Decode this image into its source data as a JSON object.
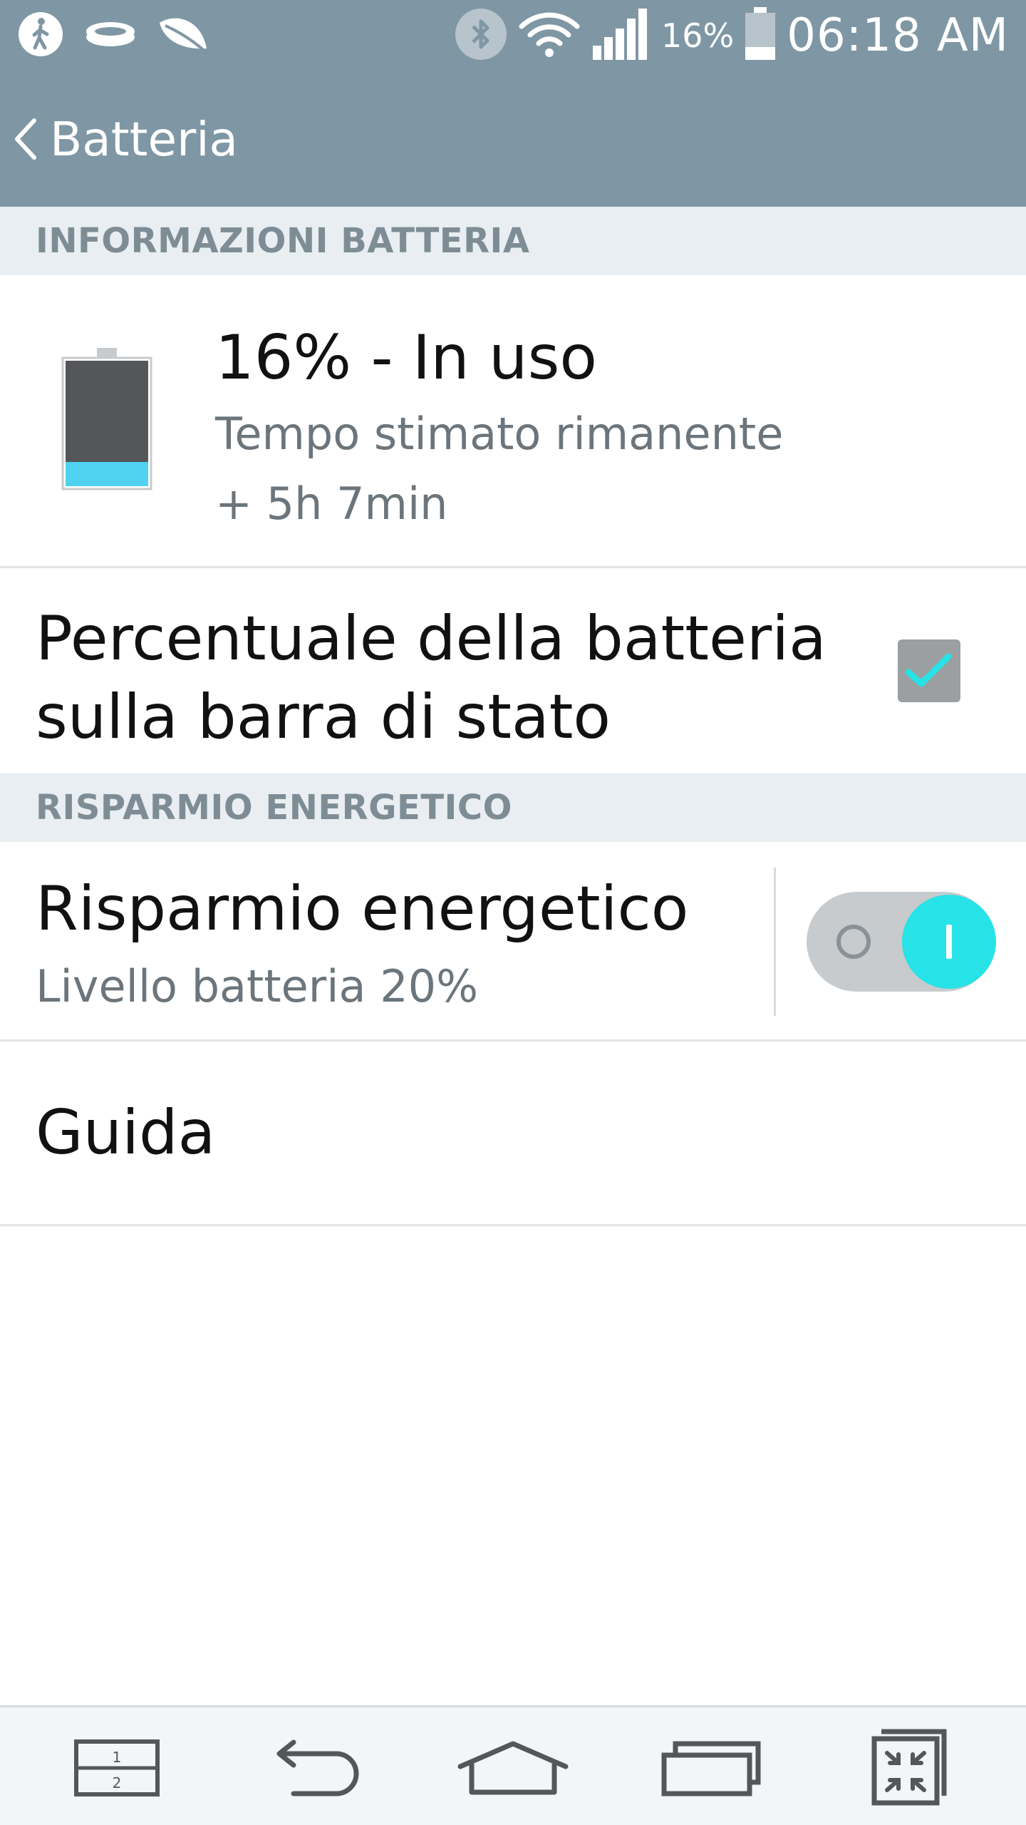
{
  "status_bar": {
    "left_icons": [
      "accessibility-icon",
      "ring-icon",
      "leaf-icon"
    ],
    "right_icons": [
      "bluetooth-icon",
      "wifi-icon",
      "signal-icon",
      "battery-icon"
    ],
    "battery_percent": "16%",
    "time": "06:18 AM"
  },
  "header": {
    "back_icon": "chevron-left-icon",
    "title": "Batteria"
  },
  "sections": {
    "battery_info": "INFORMAZIONI BATTERIA",
    "power_saving": "RISPARMIO ENERGETICO"
  },
  "battery_info": {
    "status": "16% - In uso",
    "estimate_label": "Tempo stimato rimanente",
    "estimate_value": "+ 5h 7min",
    "level_fraction": 0.16,
    "fill_color": "#4fd2f0"
  },
  "percent_setting": {
    "label": "Percentuale della batteria sulla barra di stato",
    "checked": true
  },
  "power_saver": {
    "title": "Risparmio energetico",
    "subtitle": "Livello batteria 20%",
    "enabled": true,
    "accent_color": "#27e2e6"
  },
  "guide": {
    "label": "Guida"
  },
  "nav_bar": {
    "buttons": [
      "dual-window-icon",
      "back-icon",
      "home-icon",
      "recent-apps-icon",
      "qslide-icon"
    ],
    "dual_window_labels": [
      "1",
      "2"
    ]
  },
  "colors": {
    "header_bg": "#7f97a4",
    "section_bg": "#e8eef1",
    "section_text": "#7e8d95"
  }
}
